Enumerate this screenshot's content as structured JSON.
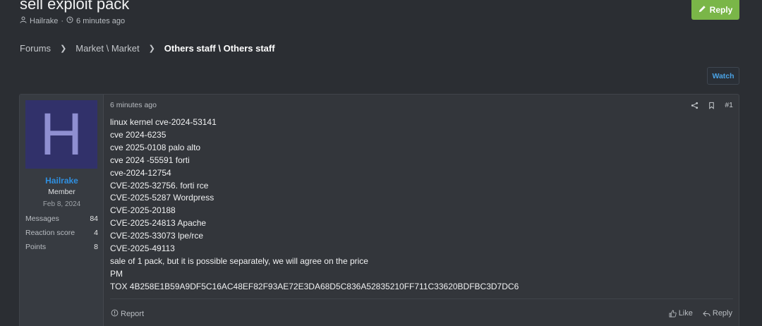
{
  "thread": {
    "title": "sell exploit pack",
    "author": "Hailrake",
    "separator": "·",
    "time": "6 minutes ago",
    "reply_button": "Reply",
    "watch_button": "Watch"
  },
  "breadcrumb": {
    "items": [
      "Forums",
      "Market \\ Market",
      "Others staff \\ Others staff"
    ]
  },
  "post": {
    "user": {
      "avatar_letter": "H",
      "name": "Hailrake",
      "title": "Member",
      "joined": "Feb 8, 2024",
      "stats": [
        {
          "label": "Messages",
          "value": "84"
        },
        {
          "label": "Reaction score",
          "value": "4"
        },
        {
          "label": "Points",
          "value": "8"
        }
      ]
    },
    "time": "6 minutes ago",
    "number": "#1",
    "lines": [
      "linux kernel cve-2024-53141",
      "cve 2024-6235",
      "cve 2025-0108 palo alto",
      "cve 2024 -55591 forti",
      "cve-2024-12754",
      "CVE-2025-32756. forti rce",
      "CVE-2025-5287 Wordpress",
      "CVE-2025-20188",
      "CVE-2025-24813 Apache",
      "CVE-2025-33073 lpe/rce",
      "CVE-2025-49113",
      "sale of 1 pack, but it is possible separately, we will agree on the price",
      "PM",
      "TOX 4B258E1B59A9DF5C16AC48EF82F93AE72E3DA68D5C836A52835210FF711C33620BDFBC3D7DC6"
    ],
    "report_label": "Report",
    "like_label": "Like",
    "reply_label": "Reply"
  },
  "colors": {
    "background": "#2b2e33",
    "accent_green": "#7ab648",
    "link_blue": "#2f8fe0",
    "avatar_bg": "#31316a",
    "avatar_letter": "#8f8fd1"
  }
}
